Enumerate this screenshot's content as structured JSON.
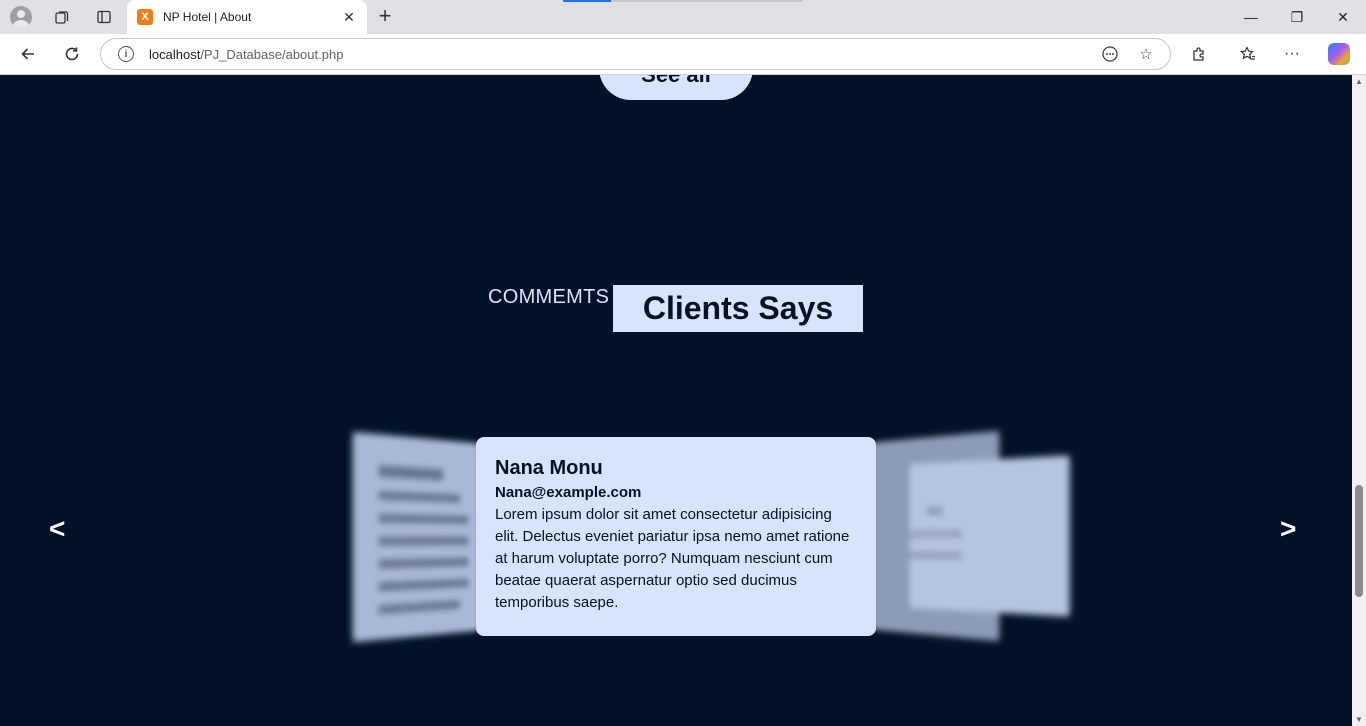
{
  "browser": {
    "tab_title": "NP Hotel | About",
    "favicon_label": "X",
    "url_host": "localhost",
    "url_path": "/PJ_Database/about.php"
  },
  "page": {
    "see_all_label": "See all",
    "section_subtitle": "COMMEMTS",
    "section_title": "Clients Says",
    "prev_label": "<",
    "next_label": ">",
    "testimonial": {
      "name": "Nana Monu",
      "email": "Nana@example.com",
      "text": "Lorem ipsum dolor sit amet consectetur adipisicing elit. Delectus eveniet pariatur ipsa nemo amet ratione at harum voluptate porro? Numquam nesciunt cum beatae quaerat aspernatur optio sed ducimus temporibus saepe."
    }
  },
  "colors": {
    "page_bg": "#011226",
    "accent_light": "#d6e5fb"
  }
}
